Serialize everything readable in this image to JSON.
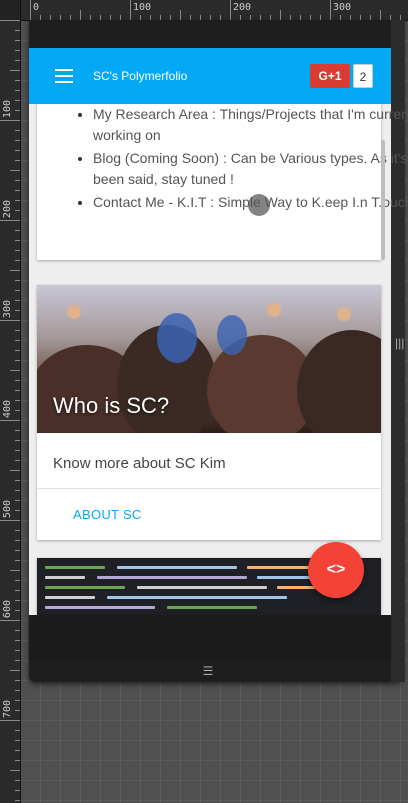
{
  "app": {
    "title": "SC's Polymerfolio"
  },
  "social": {
    "gplus_label": "G+1",
    "gplus_count": "2"
  },
  "intro_list": [
    "My Research Area : Things/Projects that I'm currently working on",
    "Blog (Coming Soon) : Can be Various types. As it's been said, stay tuned !",
    "Contact Me - K.I.T : Simple Way to K.eep I.n T.ouch"
  ],
  "about_card": {
    "image_title": "Who is SC?",
    "text": "Know more about SC Kim",
    "button_label": "ABOUT SC"
  },
  "fab": {
    "label": "<>"
  },
  "ruler": {
    "top_labels": [
      "0",
      "100",
      "200",
      "300"
    ],
    "left_labels": [
      "100",
      "200",
      "300",
      "400",
      "500",
      "600",
      "700"
    ]
  },
  "colors": {
    "appbar": "#03a9f4",
    "fab": "#f44336",
    "gplus": "#d73d32",
    "accent_text": "#03a9f4"
  },
  "icons": {
    "menu": "hamburger-icon",
    "fab": "code-icon"
  }
}
